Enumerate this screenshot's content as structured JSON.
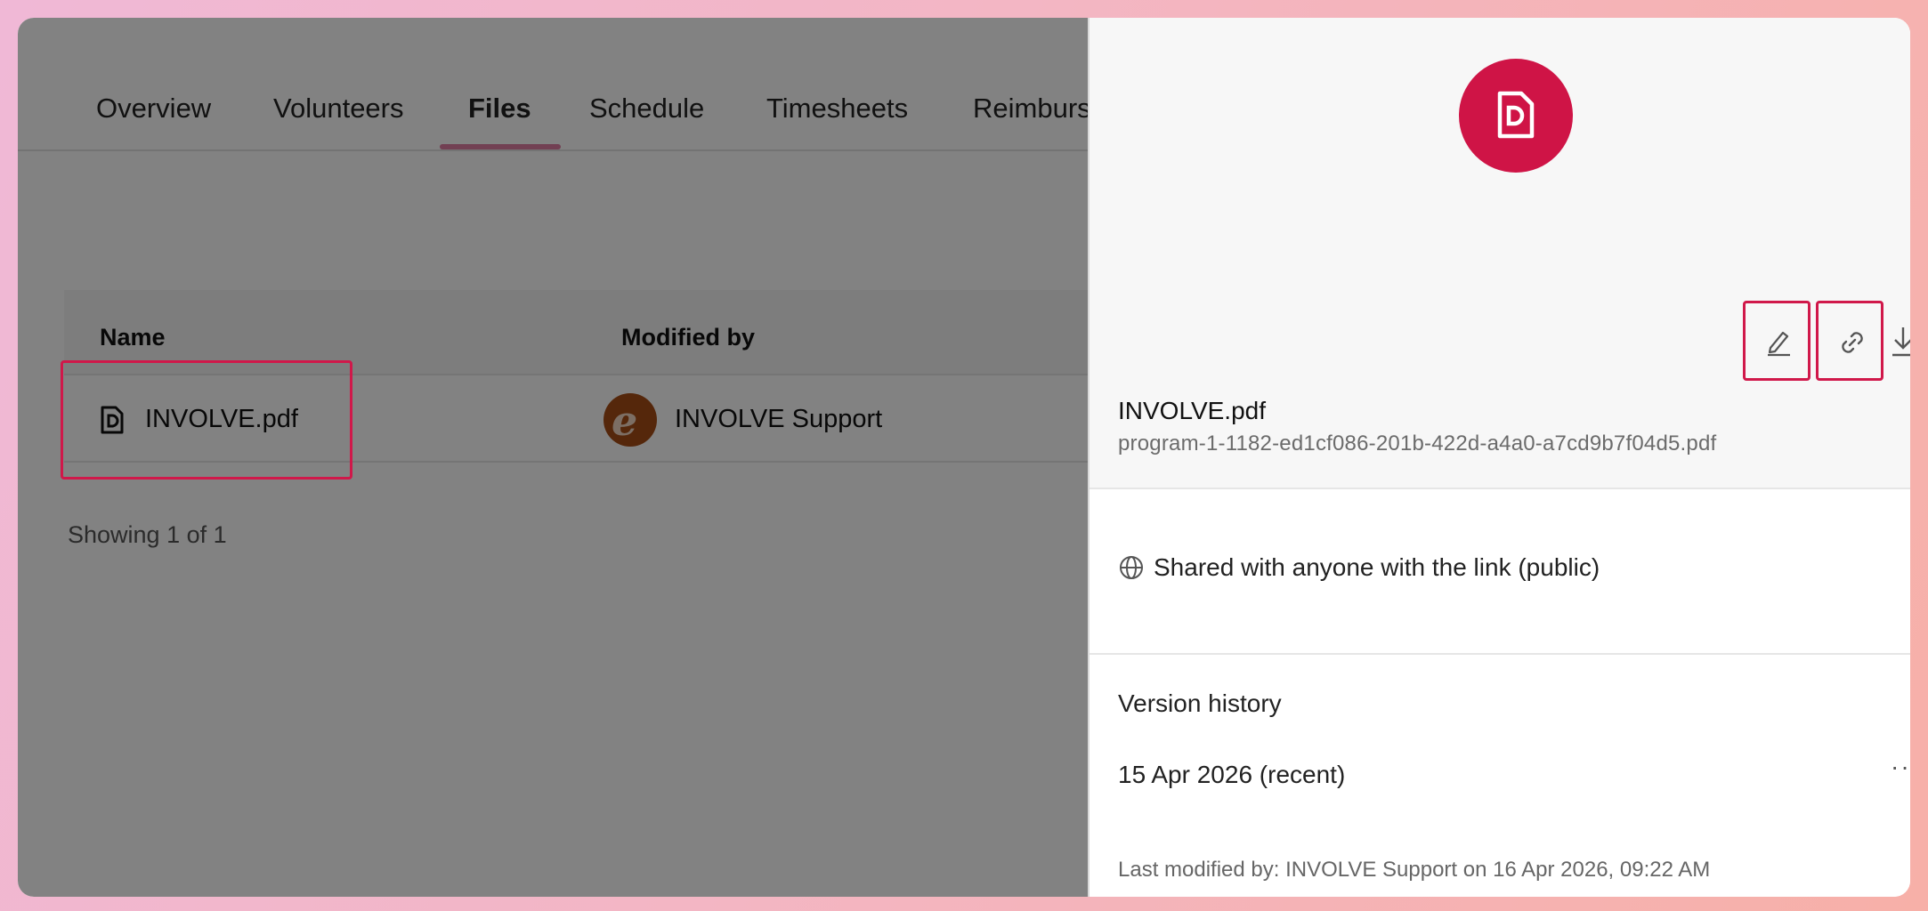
{
  "tabs": [
    {
      "label": "Overview"
    },
    {
      "label": "Volunteers"
    },
    {
      "label": "Files"
    },
    {
      "label": "Schedule"
    },
    {
      "label": "Timesheets"
    },
    {
      "label": "Reimburs"
    }
  ],
  "active_tab": "Files",
  "table": {
    "headers": {
      "name": "Name",
      "modified_by": "Modified by"
    },
    "rows": [
      {
        "name": "INVOLVE.pdf",
        "modified_by": "INVOLVE Support"
      }
    ],
    "footer": "Showing 1 of 1"
  },
  "drawer": {
    "file_title": "INVOLVE.pdf",
    "file_path": "program-1-1182-ed1cf086-201b-422d-a4a0-a7cd9b7f04d5.pdf",
    "sharing": "Shared with anyone with the link (public)",
    "version_history_title": "Version history",
    "versions": [
      {
        "label": "15 Apr 2026 (recent)"
      }
    ],
    "more_label": "···",
    "last_modified": "Last modified by: INVOLVE Support on 16 Apr 2026, 09:22 AM"
  },
  "colors": {
    "accent": "#cf1446",
    "highlight": "#d0184a",
    "tab_underline": "#e07fa3"
  },
  "icons": [
    "file-pdf-icon",
    "avatar-logo",
    "pencil-icon",
    "link-icon",
    "download-icon",
    "globe-icon",
    "more-icon"
  ]
}
